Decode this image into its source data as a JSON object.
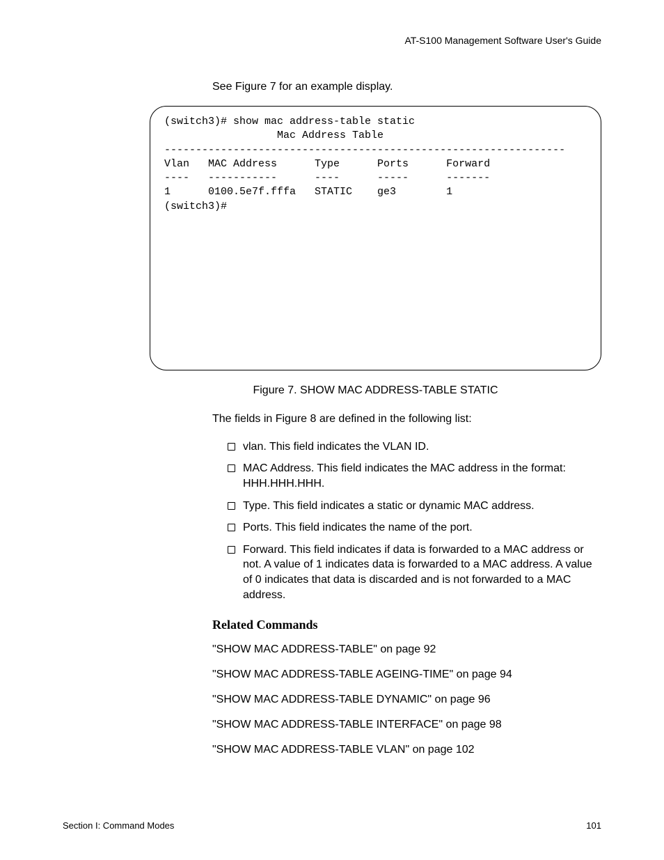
{
  "header": "AT-S100 Management Software User's Guide",
  "intro": "See Figure 7 for an example display.",
  "terminal": "(switch3)# show mac address-table static\n                  Mac Address Table\n----------------------------------------------------------------\nVlan   MAC Address      Type      Ports      Forward\n----   -----------      ----      -----      -------\n1      0100.5e7f.fffa   STATIC    ge3        1\n(switch3)#",
  "figureCaption": "Figure 7. SHOW MAC ADDRESS-TABLE STATIC",
  "fieldsIntro": "The fields in Figure 8 are defined in the following list:",
  "fields": [
    "vlan. This field indicates the VLAN ID.",
    "MAC Address. This field indicates the MAC address in the format: HHH.HHH.HHH.",
    "Type. This field indicates a static or dynamic MAC address.",
    "Ports. This field indicates the name of the port.",
    "Forward. This field indicates if data is forwarded to a MAC address or not. A value of 1 indicates data is forwarded to a MAC address. A value of 0 indicates that data is discarded and is not forwarded to a MAC address."
  ],
  "relatedHeading": "Related Commands",
  "relatedLinks": [
    "\"SHOW MAC ADDRESS-TABLE\" on page 92",
    "\"SHOW MAC ADDRESS-TABLE AGEING-TIME\" on page 94",
    "\"SHOW MAC ADDRESS-TABLE DYNAMIC\" on page 96",
    "\"SHOW MAC ADDRESS-TABLE INTERFACE\" on page 98",
    "\"SHOW MAC ADDRESS-TABLE VLAN\" on page 102"
  ],
  "footerLeft": "Section I: Command Modes",
  "footerRight": "101"
}
